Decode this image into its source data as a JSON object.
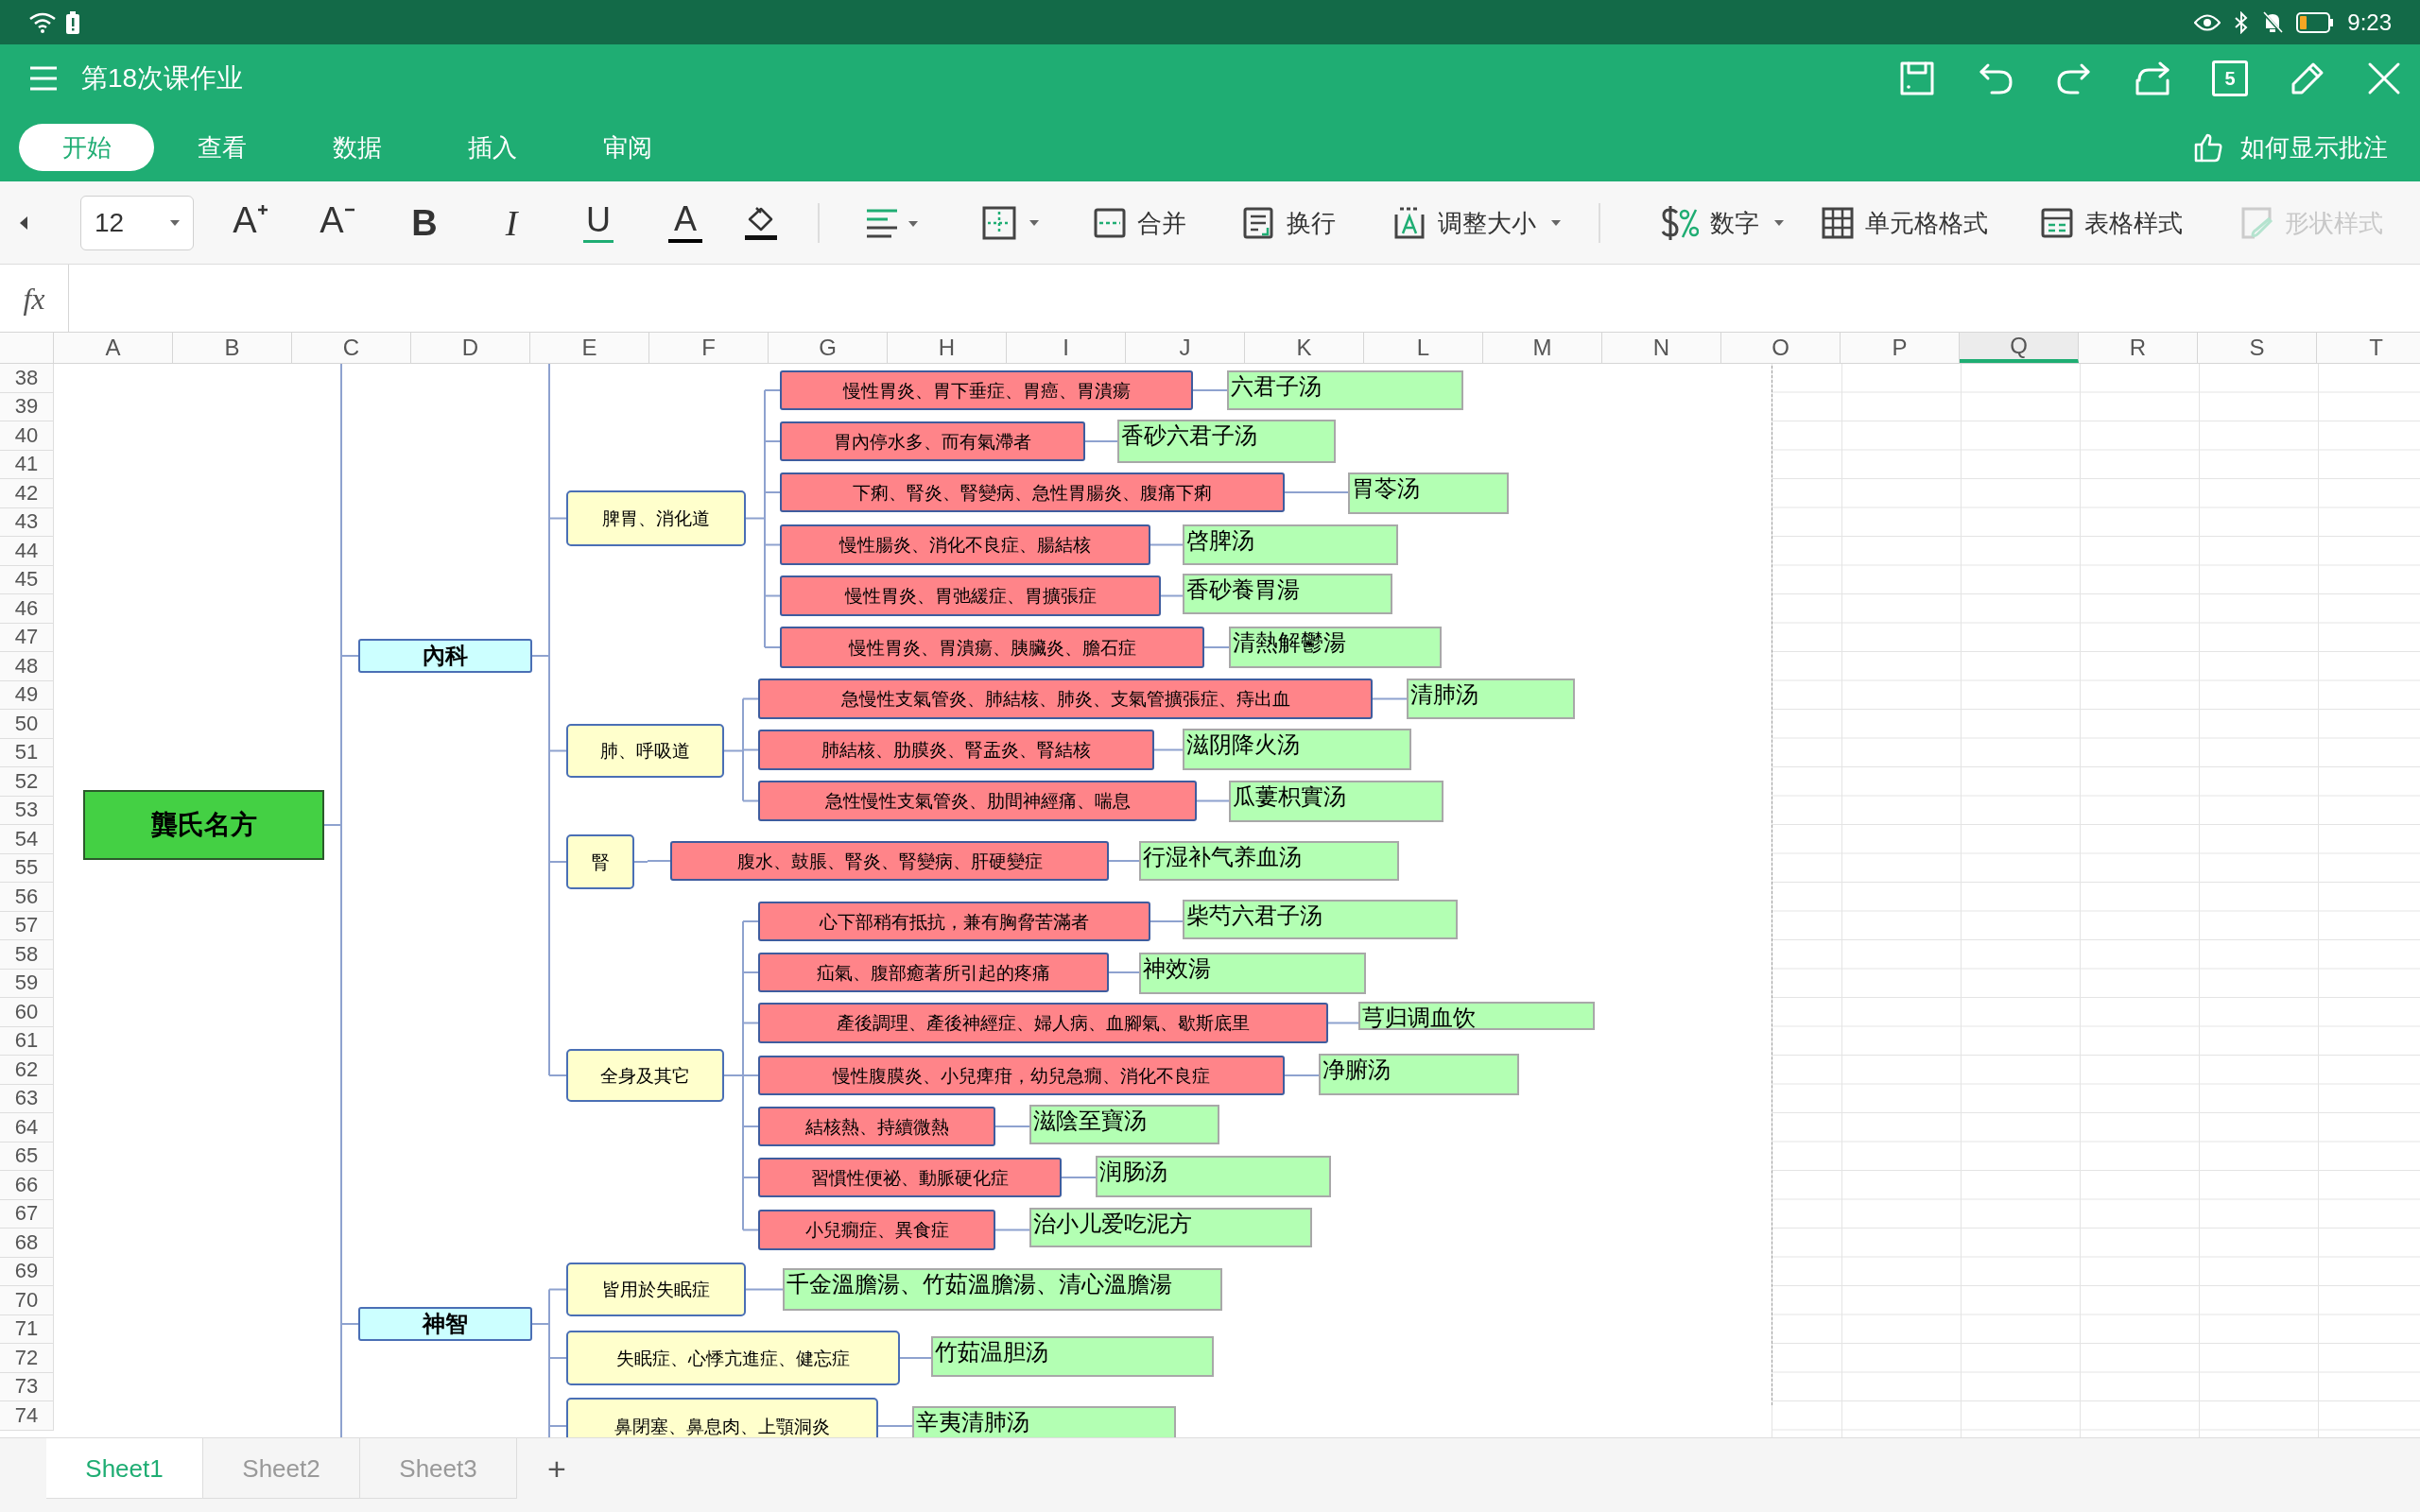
{
  "status_bar": {
    "time": "9:23"
  },
  "app_bar": {
    "title": "第18次课作业",
    "tab_count": "5",
    "comment_hint": "如何显示批注",
    "tabs": [
      {
        "label": "开始",
        "selected": true
      },
      {
        "label": "查看",
        "selected": false
      },
      {
        "label": "数据",
        "selected": false
      },
      {
        "label": "插入",
        "selected": false
      },
      {
        "label": "审阅",
        "selected": false
      }
    ]
  },
  "toolbar": {
    "font_size": "12",
    "format_buttons": [
      {
        "kind": "font_up",
        "label": "A"
      },
      {
        "kind": "font_down",
        "label": "A"
      },
      {
        "kind": "bold",
        "label": "B"
      },
      {
        "kind": "italic",
        "label": "I"
      },
      {
        "kind": "underline",
        "label": "U"
      },
      {
        "kind": "font_color",
        "label": "A"
      }
    ],
    "labeled_buttons": [
      {
        "kind": "merge",
        "label": "合并",
        "dropdown": false,
        "disabled": false
      },
      {
        "kind": "wrap",
        "label": "换行",
        "dropdown": false,
        "disabled": false
      },
      {
        "kind": "resize",
        "label": "调整大小",
        "dropdown": true,
        "disabled": false
      },
      {
        "kind": "number",
        "label": "数字",
        "dropdown": true,
        "disabled": false
      },
      {
        "kind": "cell_format",
        "label": "单元格格式",
        "dropdown": false,
        "disabled": false
      },
      {
        "kind": "table_style",
        "label": "表格样式",
        "dropdown": false,
        "disabled": false
      },
      {
        "kind": "shape_style",
        "label": "形状样式",
        "dropdown": false,
        "disabled": true
      }
    ]
  },
  "formula_bar": {
    "label": "fx"
  },
  "sheet": {
    "columns": [
      {
        "label": "A",
        "selected": false
      },
      {
        "label": "B",
        "selected": false
      },
      {
        "label": "C",
        "selected": false
      },
      {
        "label": "D",
        "selected": false
      },
      {
        "label": "E",
        "selected": false
      },
      {
        "label": "F",
        "selected": false
      },
      {
        "label": "G",
        "selected": false
      },
      {
        "label": "H",
        "selected": false
      },
      {
        "label": "I",
        "selected": false
      },
      {
        "label": "J",
        "selected": false
      },
      {
        "label": "K",
        "selected": false
      },
      {
        "label": "L",
        "selected": false
      },
      {
        "label": "M",
        "selected": false
      },
      {
        "label": "N",
        "selected": false
      },
      {
        "label": "O",
        "selected": false
      },
      {
        "label": "P",
        "selected": false
      },
      {
        "label": "Q",
        "selected": true
      },
      {
        "label": "R",
        "selected": false
      },
      {
        "label": "S",
        "selected": false
      },
      {
        "label": "T",
        "selected": false
      }
    ],
    "rows": [
      "38",
      "39",
      "40",
      "41",
      "42",
      "43",
      "44",
      "45",
      "46",
      "47",
      "48",
      "49",
      "50",
      "51",
      "52",
      "53",
      "54",
      "55",
      "56",
      "57",
      "58",
      "59",
      "60",
      "61",
      "62",
      "63",
      "64",
      "65",
      "66",
      "67",
      "68",
      "69",
      "70",
      "71",
      "72",
      "73",
      "74"
    ]
  },
  "mind_map": {
    "label": "龔氏名方",
    "children": [
      {
        "label": "內科",
        "children": [
          {
            "label": "脾胃、消化道",
            "children": [
              {
                "label": "慢性胃炎、胃下垂症、胃癌、胃潰瘍",
                "formula": "六君子汤"
              },
              {
                "label": "胃內停水多、而有氣滯者",
                "formula": "香砂六君子汤"
              },
              {
                "label": "下痢、腎炎、腎變病、急性胃腸炎、腹痛下痢",
                "formula": "胃苓汤"
              },
              {
                "label": "慢性腸炎、消化不良症、腸結核",
                "formula": "啓脾汤"
              },
              {
                "label": "慢性胃炎、胃弛緩症、胃擴張症",
                "formula": "香砂養胃湯"
              },
              {
                "label": "慢性胃炎、胃潰瘍、胰臟炎、膽石症",
                "formula": "清熱解鬱湯"
              }
            ]
          },
          {
            "label": "肺、呼吸道",
            "children": [
              {
                "label": "急慢性支氣管炎、肺結核、肺炎、支氣管擴張症、痔出血",
                "formula": "清肺汤"
              },
              {
                "label": "肺結核、肋膜炎、腎盂炎、腎結核",
                "formula": "滋阴降火汤"
              },
              {
                "label": "急性慢性支氣管炎、肋間神經痛、喘息",
                "formula": "瓜蔞枳實汤"
              }
            ]
          },
          {
            "label": "腎",
            "children": [
              {
                "label": "腹水、鼓脹、腎炎、腎變病、肝硬變症",
                "formula": "行湿补气养血汤"
              }
            ]
          },
          {
            "label": "全身及其它",
            "children": [
              {
                "label": "心下部稍有抵抗，兼有胸脅苦滿者",
                "formula": "柴芍六君子汤"
              },
              {
                "label": "疝氣、腹部癒著所引起的疼痛",
                "formula": "神效湯"
              },
              {
                "label": "產後調理、產後神經症、婦人病、血腳氣、歇斯底里",
                "formula": "芎归调血饮"
              },
              {
                "label": "慢性腹膜炎、小兒痺疳，幼兒急癇、消化不良症",
                "formula": "净腑汤"
              },
              {
                "label": "結核熱、持續微熱",
                "formula": "滋陰至寶汤"
              },
              {
                "label": "習慣性便祕、動脈硬化症",
                "formula": "润肠汤"
              },
              {
                "label": "小兒癇症、異食症",
                "formula": "治小儿爱吃泥方"
              }
            ]
          }
        ]
      },
      {
        "label": "神智",
        "children": [
          {
            "label": "皆用於失眠症",
            "formula": "千金溫膽湯、竹茹溫膽湯、清心溫膽湯"
          },
          {
            "label": "失眠症、心悸亢進症、健忘症",
            "formula": "竹茹温胆汤"
          },
          {
            "label": "鼻閉塞、鼻息肉、上顎洞炎",
            "formula": "辛夷清肺汤"
          }
        ]
      }
    ]
  },
  "sheet_tabs": [
    {
      "label": "Sheet1",
      "selected": true
    },
    {
      "label": "Sheet2",
      "selected": false
    },
    {
      "label": "Sheet3",
      "selected": false
    }
  ],
  "add_sheet": "+"
}
